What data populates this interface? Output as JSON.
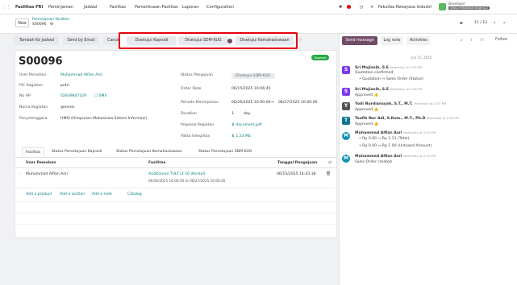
{
  "topbar": {
    "menus": [
      "Fasilitas FRI",
      "Peminjaman",
      "Jadwal",
      "Fasilitas",
      "Pemeriksaan Fasilitas",
      "Laporan",
      "Configuration"
    ],
    "company": "Fakultas Rekayasa Industri",
    "user_role": "Developer",
    "user_db": "odoo-metalbase-staging-2"
  },
  "control": {
    "new_label": "New",
    "breadcrumb_parent": "Peminjaman Fasilitas",
    "record": "S00096",
    "pager": "11 / 12"
  },
  "statusbar": {
    "tambah": "Tambah Ke Jadwal",
    "send": "Send by Email",
    "cancel": "Cancel",
    "stages": [
      "Disetujui Kaprodi",
      "Disetujui SDM-KUG",
      "Disetujui Kemahasiswaan"
    ]
  },
  "form": {
    "title": "S00096",
    "ribbon": "Booked",
    "left": [
      {
        "label": "User Pemohon",
        "value": "Muhammad Alfian Asri"
      },
      {
        "label": "PIC Kegiatan",
        "value": "putri"
      },
      {
        "label": "No HP",
        "value": "02839847329",
        "action": "SMS"
      },
      {
        "label": "Nama Kegiatan",
        "value": "genesis"
      },
      {
        "label": "Penyelenggara",
        "value": "HMSI (Himpunan Mahasiswa Sistem Informasi)"
      }
    ],
    "right": [
      {
        "label": "Status Pengajuan",
        "value": "Disetujui SDM-KUG"
      },
      {
        "label": "Order Date",
        "value": "06/15/2025 16:06:45"
      },
      {
        "label": "Periode Peminjaman",
        "value": "06/26/2025 16:00:00",
        "value2": "06/27/2025 16:00:00"
      },
      {
        "label": "Duration",
        "value": "1",
        "unit": "day"
      },
      {
        "label": "Proposal Kegiatan",
        "value": "document.pdf"
      },
      {
        "label": "Pakta Integritas",
        "value": "1.23 Mb"
      }
    ]
  },
  "tabs": [
    "Fasilitas",
    "Status Persetujuan Kaprodi",
    "Status Persetujuan Kemahasiswaan",
    "Status Persetujuan SDM KUG"
  ],
  "table": {
    "headers": [
      "User Pemohon",
      "Fasilitas",
      "Tanggal Pengajuan"
    ],
    "rows": [
      {
        "user": "Muhammad Alfian Asri",
        "facility": "Auditorium TULT Lt 16 (Rental)",
        "period": "06/26/2025 16:00:00 to 06/27/2025 16:00:00",
        "date": "06/15/2025 14:43:38"
      }
    ],
    "actions": [
      "Add a product",
      "Add a section",
      "Add a note",
      "Catalog"
    ]
  },
  "chatter": {
    "buttons": [
      "Send message",
      "Log note",
      "Activities"
    ],
    "follow": "Follow",
    "date_sep": "Jun 15, 2025",
    "messages": [
      {
        "author": "Sri Mujiasih, S.E",
        "time": "Yesterday at 4:55 PM",
        "initial": "S",
        "color": "#7c3aed",
        "lines": [
          "Quotation confirmed",
          "• Quotation → Sales Order (Status)"
        ]
      },
      {
        "author": "Sri Mujiasih, S.E",
        "time": "Yesterday at 4:56 PM",
        "initial": "S",
        "color": "#7c3aed",
        "lines": [
          "Approved 👍"
        ]
      },
      {
        "author": "Yodi Nurdiansyah, S.T., M.T.",
        "time": "Yesterday at 2:33 PM",
        "initial": "Y",
        "color": "#555",
        "lines": [
          "Approved 👍"
        ]
      },
      {
        "author": "Taufik Nur Adi, S.Kom., M.T., Ph.D",
        "time": "Yesterday at 2:58 PM",
        "initial": "T",
        "color": "#0e7490",
        "lines": [
          "Approved 👍"
        ]
      },
      {
        "author": "Muhammad Alfian Asri",
        "time": "Yesterday at 2:43 PM",
        "initial": "M",
        "color": "#0891b2",
        "lines": [
          "• Rp 0.00 → Rp 1.11 (Total)",
          "• Rp 0.00 → Rp 1.00 (Untaxed Amount)"
        ]
      },
      {
        "author": "Muhammad Alfian Asri",
        "time": "Yesterday at 2:43 PM",
        "initial": "M",
        "color": "#0891b2",
        "lines": [
          "Sales Order created"
        ]
      }
    ]
  },
  "colors": {
    "accent": "#714b67",
    "teal": "#017e84",
    "highlight": "#e8000b",
    "ribbon": "#28a745"
  }
}
